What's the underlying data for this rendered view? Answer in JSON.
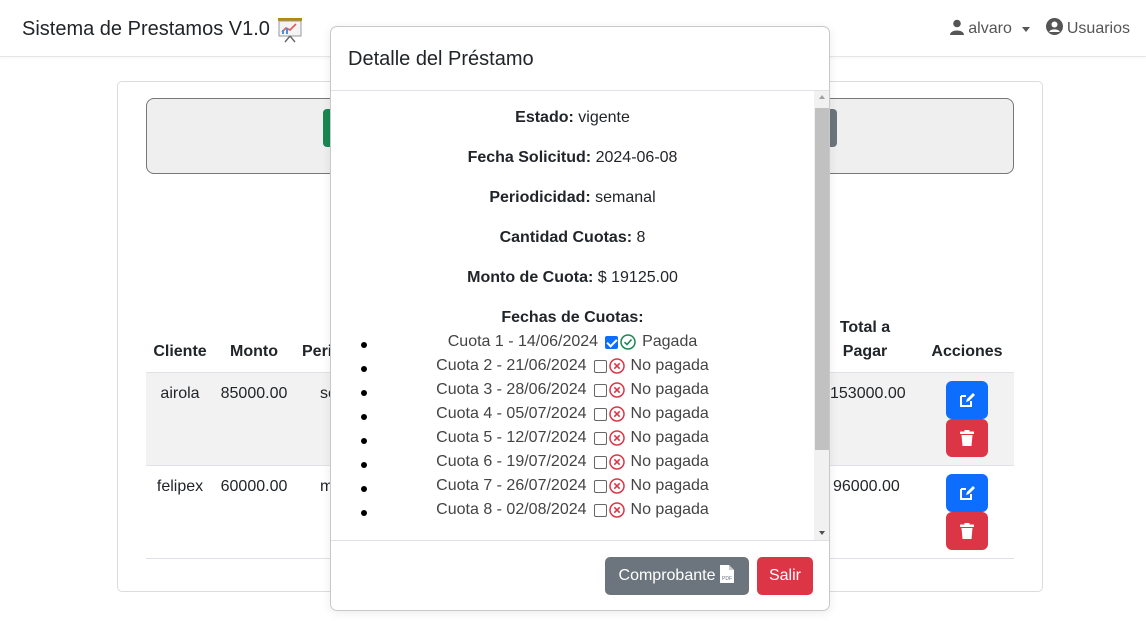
{
  "navbar": {
    "brand": "Sistema de Prestamos V1.0",
    "user_label": "alvaro",
    "users_label": "Usuarios"
  },
  "table": {
    "headers": {
      "cliente": "Cliente",
      "monto": "Monto",
      "periodicidad_partial": "Peri",
      "total_line1": "Total a",
      "total_line2": "Pagar",
      "acciones": "Acciones"
    },
    "rows": [
      {
        "cliente": "airola",
        "monto": "85000.00",
        "periodicidad_partial": "se",
        "total": "153000.00"
      },
      {
        "cliente": "felipex",
        "monto": "60000.00",
        "periodicidad_partial": "m",
        "total": "96000.00"
      }
    ]
  },
  "modal": {
    "title": "Detalle del Préstamo",
    "estado_label": "Estado:",
    "estado_value": "vigente",
    "fecha_label": "Fecha Solicitud:",
    "fecha_value": "2024-06-08",
    "periodicidad_label": "Periodicidad:",
    "periodicidad_value": "semanal",
    "cantidad_label": "Cantidad Cuotas:",
    "cantidad_value": "8",
    "monto_label": "Monto de Cuota:",
    "monto_value": "$ 19125.00",
    "fechas_title": "Fechas de Cuotas:",
    "cuotas": [
      {
        "text": "Cuota 1 - 14/06/2024",
        "status": "Pagada",
        "paid": true
      },
      {
        "text": "Cuota 2 - 21/06/2024",
        "status": "No pagada",
        "paid": false
      },
      {
        "text": "Cuota 3 - 28/06/2024",
        "status": "No pagada",
        "paid": false
      },
      {
        "text": "Cuota 4 - 05/07/2024",
        "status": "No pagada",
        "paid": false
      },
      {
        "text": "Cuota 5 - 12/07/2024",
        "status": "No pagada",
        "paid": false
      },
      {
        "text": "Cuota 6 - 19/07/2024",
        "status": "No pagada",
        "paid": false
      },
      {
        "text": "Cuota 7 - 26/07/2024",
        "status": "No pagada",
        "paid": false
      },
      {
        "text": "Cuota 8 - 02/08/2024",
        "status": "No pagada",
        "paid": false
      }
    ],
    "comprobante_label": "Comprobante",
    "salir_label": "Salir"
  },
  "colors": {
    "primary": "#0d6efd",
    "danger": "#dc3545",
    "secondary": "#6c757d",
    "success": "#198754"
  }
}
